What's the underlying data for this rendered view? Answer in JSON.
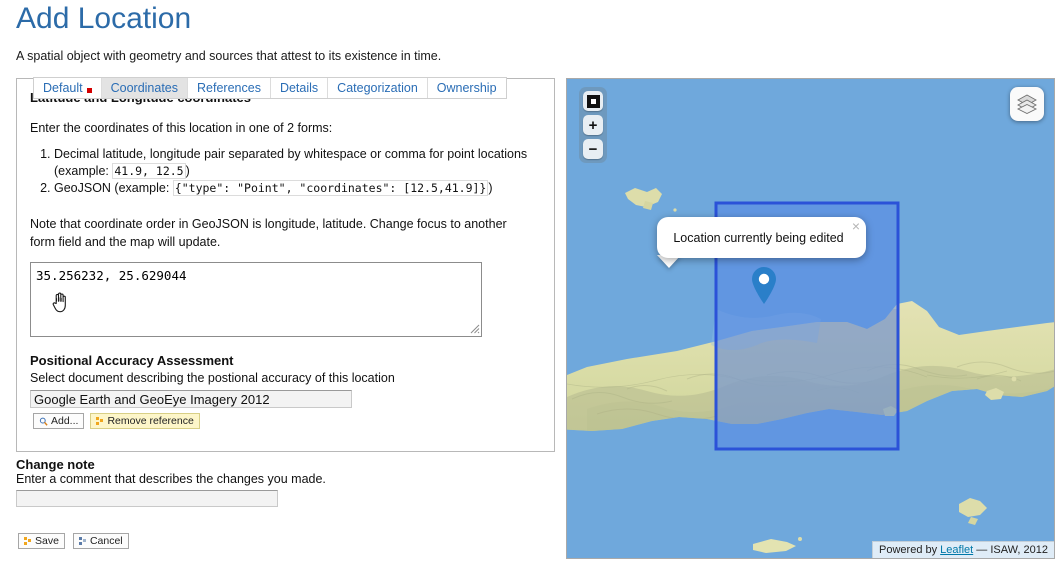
{
  "page": {
    "title": "Add Location",
    "description": "A spatial object with geometry and sources that attest to its existence in time."
  },
  "tabs": [
    {
      "label": "Default",
      "selected": false,
      "required_marker": true
    },
    {
      "label": "Coordinates",
      "selected": true,
      "required_marker": false
    },
    {
      "label": "References",
      "selected": false,
      "required_marker": false
    },
    {
      "label": "Details",
      "selected": false,
      "required_marker": false
    },
    {
      "label": "Categorization",
      "selected": false,
      "required_marker": false
    },
    {
      "label": "Ownership",
      "selected": false,
      "required_marker": false
    }
  ],
  "coordinates_panel": {
    "heading": "Latitude and Longitude coordinates",
    "intro": "Enter the coordinates of this location in one of 2 forms:",
    "form_options": [
      {
        "text_before": "Decimal latitude, longitude pair separated by whitespace or comma for point locations (example: ",
        "code": "41.9, 12.5",
        "text_after": ")"
      },
      {
        "text_before": "GeoJSON (example: ",
        "code": "{\"type\": \"Point\", \"coordinates\": [12.5,41.9]}",
        "text_after": ")"
      }
    ],
    "note": "Note that coordinate order in GeoJSON is longitude, latitude. Change focus to another form field and the map will update.",
    "textarea_value": "35.256232, 25.629044",
    "textarea_placeholder": ""
  },
  "positional_accuracy": {
    "heading": "Positional Accuracy Assessment",
    "description": "Select document describing the postional accuracy of this location",
    "value": "Google Earth and GeoEye Imagery 2012",
    "placeholder": "",
    "add_label": "Add...",
    "remove_label": "Remove reference"
  },
  "change_note": {
    "heading": "Change note",
    "description": "Enter a comment that describes the changes you made.",
    "value": "",
    "placeholder": ""
  },
  "actions": {
    "save_label": "Save",
    "cancel_label": "Cancel"
  },
  "map": {
    "zoom_controls": {
      "fit_bounds_title": "Fit bounds",
      "zoom_in_label": "+",
      "zoom_out_label": "−"
    },
    "layers_title": "Layers",
    "popup": {
      "text": "Location currently being edited",
      "close_label": "×"
    },
    "attribution": {
      "prefix": "Powered by ",
      "link_label": "Leaflet",
      "suffix": " — ISAW, 2012"
    }
  },
  "colors": {
    "title_blue": "#2c6ba8",
    "tab_link_blue": "#2a6db5",
    "required_red": "#d40000",
    "ocean_blue": "#6fa8dc",
    "land_khaki": "#ddddaa",
    "highlight_rect_stroke": "#2b52d8",
    "highlight_rect_fill": "#4f7fe8",
    "marker_blue": "#2a7fc9",
    "remove_button_yellow": "#fdf6c9"
  }
}
